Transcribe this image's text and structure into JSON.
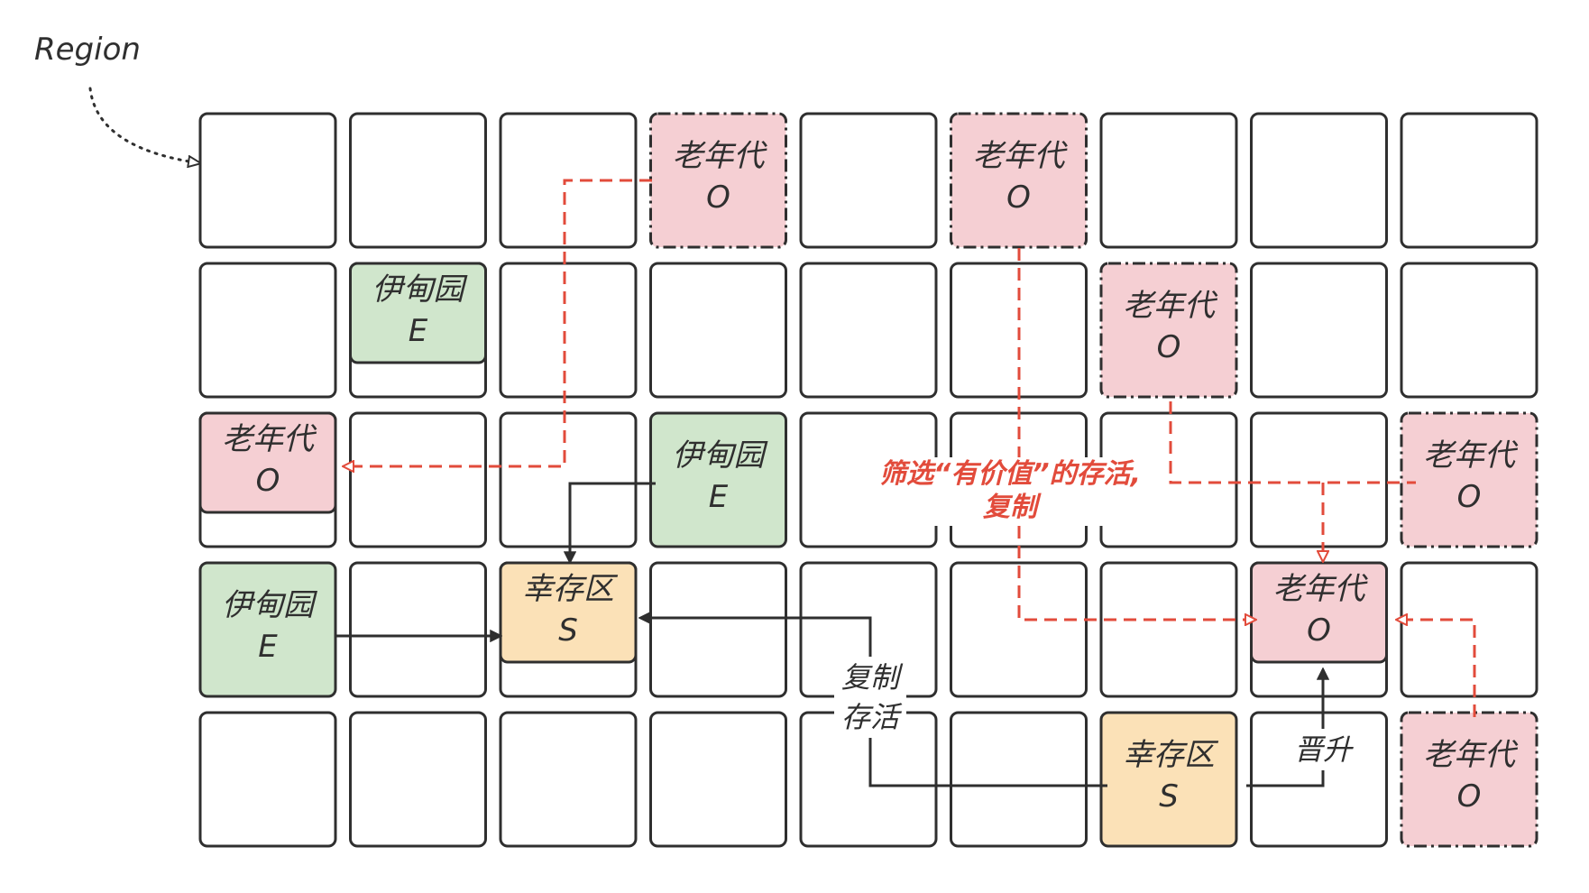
{
  "region_label": "Region",
  "grid": {
    "rows": 5,
    "cols": 9
  },
  "colors": {
    "old": "#f5cfd3",
    "eden": "#d0e6cc",
    "survivor": "#fbe1b7",
    "stroke": "#2f2f2f",
    "flow_red": "#e24b3b",
    "flow_dark": "#2f2f2f"
  },
  "cells": [
    {
      "row": 0,
      "col": 3,
      "type": "old",
      "name": "老年代",
      "code": "O",
      "border": "dashdot"
    },
    {
      "row": 0,
      "col": 5,
      "type": "old",
      "name": "老年代",
      "code": "O",
      "border": "dashdot"
    },
    {
      "row": 1,
      "col": 1,
      "type": "eden",
      "name": "伊甸园",
      "code": "E",
      "partial": true
    },
    {
      "row": 1,
      "col": 6,
      "type": "old",
      "name": "老年代",
      "code": "O",
      "border": "dashdot"
    },
    {
      "row": 2,
      "col": 0,
      "type": "old",
      "name": "老年代",
      "code": "O",
      "partial": true
    },
    {
      "row": 2,
      "col": 3,
      "type": "eden",
      "name": "伊甸园",
      "code": "E"
    },
    {
      "row": 2,
      "col": 8,
      "type": "old",
      "name": "老年代",
      "code": "O",
      "border": "dashdot"
    },
    {
      "row": 3,
      "col": 0,
      "type": "eden",
      "name": "伊甸园",
      "code": "E"
    },
    {
      "row": 3,
      "col": 2,
      "type": "survivor",
      "name": "幸存区",
      "code": "S",
      "partial": true
    },
    {
      "row": 3,
      "col": 7,
      "type": "old",
      "name": "老年代",
      "code": "O",
      "partial": true
    },
    {
      "row": 4,
      "col": 6,
      "type": "survivor",
      "name": "幸存区",
      "code": "S"
    },
    {
      "row": 4,
      "col": 8,
      "type": "old",
      "name": "老年代",
      "code": "O",
      "border": "dashdot"
    }
  ],
  "annotations": {
    "mixed_gc_line1": "筛选“有价值”的存活,",
    "mixed_gc_line2": "复制",
    "copy_live_line1": "复制",
    "copy_live_line2": "存活",
    "promote": "晋升"
  }
}
